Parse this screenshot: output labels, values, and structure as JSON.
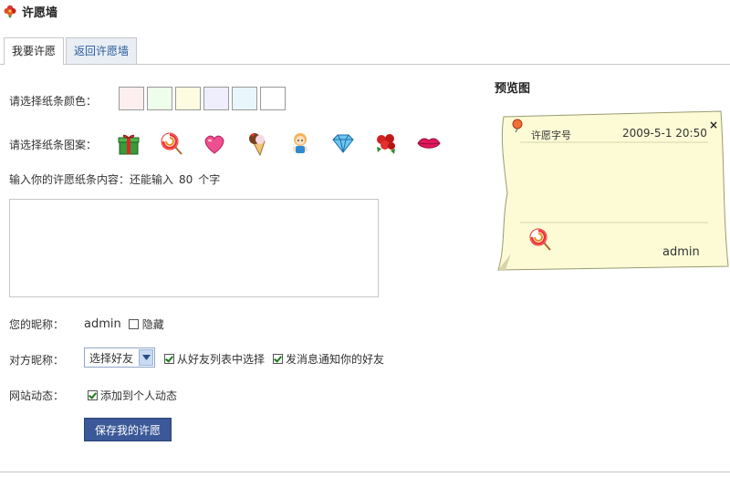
{
  "header": {
    "title": "许愿墙",
    "icon": "flower-icon"
  },
  "tabs": [
    {
      "label": "我要许愿",
      "active": true
    },
    {
      "label": "返回许愿墙",
      "active": false
    }
  ],
  "form": {
    "color_label": "请选择纸条颜色：",
    "colors": [
      "#fdeff0",
      "#effdeb",
      "#fdfbe0",
      "#eeeefd",
      "#e9f7fc",
      "#ffffff"
    ],
    "pattern_label": "请选择纸条图案：",
    "patterns": [
      "gift-icon",
      "lollipop-icon",
      "heart-icon",
      "ice-cream-icon",
      "doll-icon",
      "diamond-icon",
      "rose-bouquet-icon",
      "lips-icon"
    ],
    "content_prefix": "输入你的许愿纸条内容：还能输入",
    "content_count": "80",
    "content_suffix": "个字",
    "textarea_value": "",
    "nickname_label": "您的昵称：",
    "nickname_value": "admin",
    "hide_label": "隐藏",
    "hide_checked": false,
    "target_label": "对方昵称：",
    "friend_select_value": "选择好友",
    "from_friends_label": "从好友列表中选择",
    "from_friends_checked": true,
    "notify_label": "发消息通知你的好友",
    "notify_checked": true,
    "feed_label": "网站动态：",
    "feed_option_label": "添加到个人动态",
    "feed_checked": true,
    "save_label": "保存我的许愿"
  },
  "preview": {
    "title": "预览图",
    "note_title": "许愿字号",
    "note_date": "2009-5-1 20:50",
    "note_author": "admin",
    "note_color": "#fcfbd6"
  }
}
